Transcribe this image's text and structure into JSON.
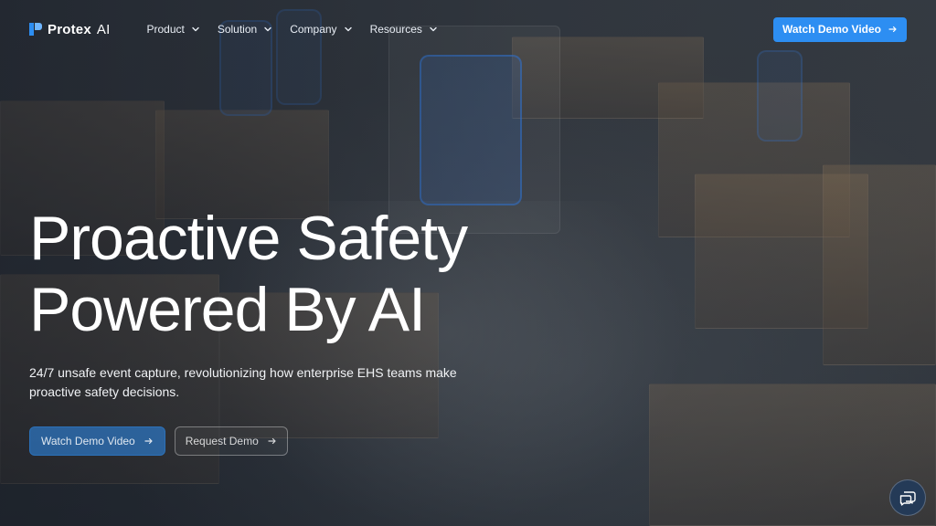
{
  "brand": {
    "name": "Protex",
    "suffix": "AI",
    "logo_icon": "protex-logo-icon",
    "accent_color": "#2d8ef2"
  },
  "nav": {
    "items": [
      {
        "label": "Product",
        "icon": "chevron-down-icon"
      },
      {
        "label": "Solution",
        "icon": "chevron-down-icon"
      },
      {
        "label": "Company",
        "icon": "chevron-down-icon"
      },
      {
        "label": "Resources",
        "icon": "chevron-down-icon"
      }
    ],
    "cta_label": "Watch Demo Video",
    "cta_icon": "arrow-right-icon"
  },
  "hero": {
    "title_line1": "Proactive Safety",
    "title_line2": "Powered By AI",
    "subtitle": "24/7 unsafe event capture, revolutionizing how enterprise EHS teams make proactive safety decisions.",
    "primary_cta": "Watch Demo Video",
    "secondary_cta": "Request Demo"
  },
  "chat": {
    "icon": "chat-bubble-icon"
  }
}
